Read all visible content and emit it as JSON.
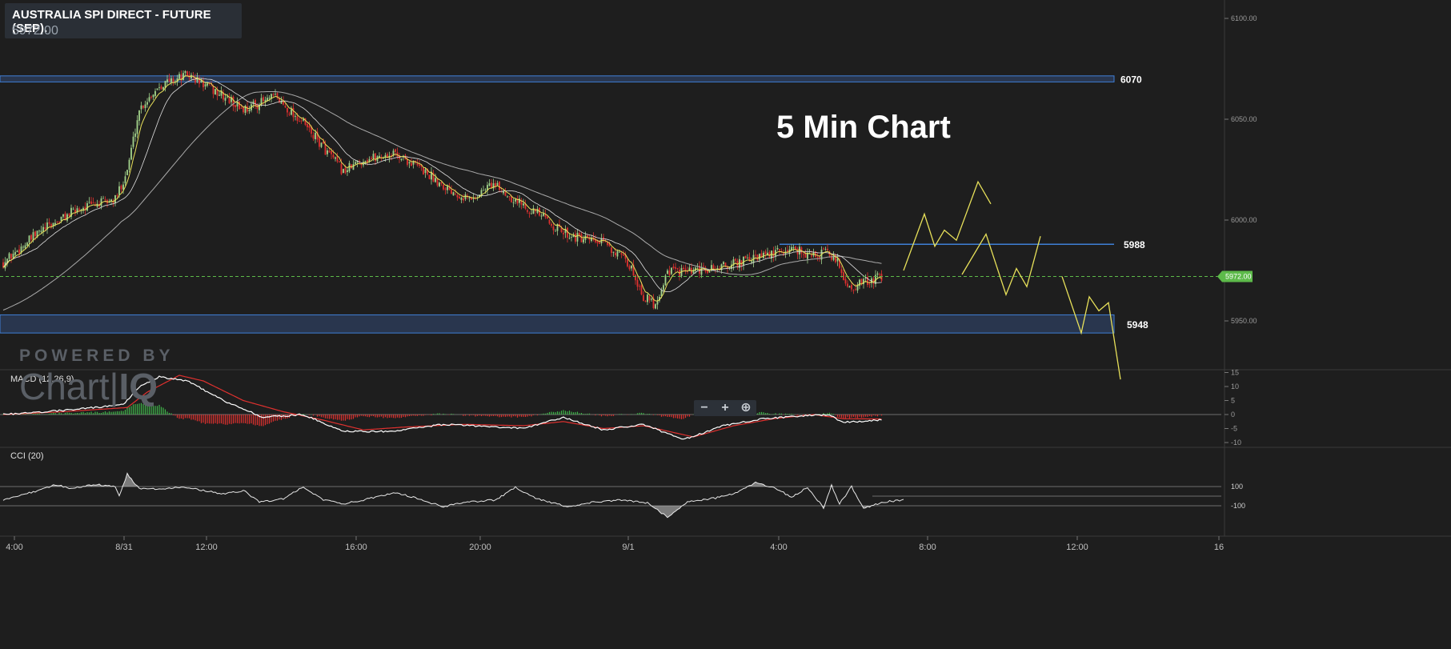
{
  "header": {
    "title": "AUSTRALIA SPI DIRECT - FUTURE (SEP).",
    "price": "5972.00"
  },
  "watermark": {
    "top": "POWERED BY",
    "logo_a": "Chart",
    "logo_b": "IQ"
  },
  "zoom": {
    "minus": "−",
    "plus": "+",
    "fit": "⊕"
  },
  "annotation": "5 Min Chart",
  "colors": {
    "background": "#1e1e1e",
    "up": "#a3d48c",
    "down": "#e0312f",
    "ema_fast": "#e8e15a",
    "ma_slow": "#bdbdbd",
    "level_line": "#3f7fd6",
    "projection": "#e8e15a",
    "price_tag": "#5dba4a",
    "macd": "#ffffff",
    "signal": "#e0312f"
  },
  "chart_data": [
    {
      "type": "candlestick",
      "title": "AUSTRALIA SPI DIRECT - FUTURE (SEP).",
      "ylim": [
        5913,
        6114
      ],
      "y_ticks": [
        "6100.00",
        "6050.00",
        "6000.00",
        "5950.00"
      ],
      "x_ticks": [
        "4:00",
        "8/31",
        "12:00",
        "16:00",
        "20:00",
        "9/1",
        "4:00",
        "8:00",
        "12:00",
        "16"
      ],
      "last_price": "5972.00",
      "levels": [
        {
          "label": "6070",
          "low": 6068.5,
          "high": 6071.5
        },
        {
          "label": "5988",
          "value": 5988
        },
        {
          "label": "5948",
          "low": 5944,
          "high": 5953
        }
      ],
      "trend_anchors": [
        [
          0,
          5979
        ],
        [
          18,
          5994
        ],
        [
          38,
          6006
        ],
        [
          56,
          6010
        ],
        [
          62,
          6025
        ],
        [
          68,
          6055
        ],
        [
          78,
          6067
        ],
        [
          92,
          6072
        ],
        [
          104,
          6065
        ],
        [
          120,
          6055
        ],
        [
          136,
          6061
        ],
        [
          150,
          6048
        ],
        [
          160,
          6036
        ],
        [
          170,
          6024
        ],
        [
          180,
          6030
        ],
        [
          196,
          6033
        ],
        [
          208,
          6026
        ],
        [
          222,
          6016
        ],
        [
          234,
          6010
        ],
        [
          244,
          6018
        ],
        [
          256,
          6010
        ],
        [
          266,
          6004
        ],
        [
          278,
          5995
        ],
        [
          290,
          5990
        ],
        [
          302,
          5988
        ],
        [
          314,
          5976
        ],
        [
          320,
          5962
        ],
        [
          326,
          5958
        ],
        [
          332,
          5975
        ],
        [
          342,
          5974
        ],
        [
          356,
          5976
        ],
        [
          372,
          5980
        ],
        [
          388,
          5984
        ],
        [
          396,
          5986
        ],
        [
          404,
          5982
        ],
        [
          412,
          5984
        ],
        [
          418,
          5978
        ],
        [
          422,
          5966
        ],
        [
          430,
          5969
        ],
        [
          440,
          5972
        ]
      ],
      "projection": [
        {
          "points": [
            [
              1129,
              5975
            ],
            [
              1155,
              6003
            ],
            [
              1168,
              5987
            ],
            [
              1180,
              5995
            ],
            [
              1195,
              5990
            ],
            [
              1222,
              6019
            ],
            [
              1238,
              6008
            ]
          ]
        },
        {
          "points": [
            [
              1202,
              5973
            ],
            [
              1232,
              5993
            ],
            [
              1257,
              5963
            ],
            [
              1270,
              5976
            ],
            [
              1283,
              5967
            ],
            [
              1300,
              5992
            ]
          ]
        },
        {
          "points": [
            [
              1327,
              5972
            ],
            [
              1351,
              5944
            ],
            [
              1361,
              5962
            ],
            [
              1373,
              5955
            ],
            [
              1385,
              5959
            ],
            [
              1400,
              5921
            ]
          ]
        }
      ]
    },
    {
      "type": "line",
      "title": "MACD (12,26,9)",
      "ylim": [
        -13,
        16
      ],
      "y_ticks": [
        "15",
        "10",
        "5",
        "0",
        "-5",
        "-10"
      ],
      "series": [
        {
          "name": "MACD",
          "anchors": [
            [
              0,
              0
            ],
            [
              30,
              1.5
            ],
            [
              60,
              3.5
            ],
            [
              68,
              10
            ],
            [
              78,
              13.5
            ],
            [
              92,
              12
            ],
            [
              110,
              5
            ],
            [
              130,
              -1
            ],
            [
              150,
              0
            ],
            [
              170,
              -6
            ],
            [
              195,
              -6
            ],
            [
              220,
              -3.5
            ],
            [
              260,
              -5
            ],
            [
              280,
              -1
            ],
            [
              300,
              -5.5
            ],
            [
              320,
              -3.5
            ],
            [
              340,
              -9
            ],
            [
              360,
              -4
            ],
            [
              380,
              -1.5
            ],
            [
              400,
              -0.5
            ],
            [
              412,
              0
            ],
            [
              420,
              -2.8
            ],
            [
              440,
              -1.8
            ]
          ]
        },
        {
          "name": "Signal",
          "anchors": [
            [
              0,
              0
            ],
            [
              30,
              1
            ],
            [
              62,
              2.5
            ],
            [
              72,
              8
            ],
            [
              88,
              14
            ],
            [
              100,
              12
            ],
            [
              120,
              5
            ],
            [
              140,
              1
            ],
            [
              160,
              -2
            ],
            [
              180,
              -5.5
            ],
            [
              200,
              -4.5
            ],
            [
              230,
              -3.5
            ],
            [
              260,
              -4
            ],
            [
              280,
              -2.5
            ],
            [
              300,
              -5
            ],
            [
              320,
              -4
            ],
            [
              345,
              -8
            ],
            [
              365,
              -4
            ],
            [
              385,
              -1.5
            ],
            [
              405,
              0
            ],
            [
              420,
              -1.5
            ],
            [
              440,
              -1.6
            ]
          ]
        }
      ]
    },
    {
      "type": "area",
      "title": "CCI (20)",
      "ylim": [
        -300,
        240
      ],
      "y_ticks": [
        "100",
        "-100"
      ],
      "series": [
        {
          "name": "CCI",
          "anchors": [
            [
              0,
              -40
            ],
            [
              8,
              10
            ],
            [
              18,
              60
            ],
            [
              26,
              120
            ],
            [
              34,
              80
            ],
            [
              46,
              120
            ],
            [
              56,
              100
            ],
            [
              58,
              10
            ],
            [
              62,
              230
            ],
            [
              68,
              80
            ],
            [
              78,
              70
            ],
            [
              90,
              100
            ],
            [
              100,
              60
            ],
            [
              110,
              20
            ],
            [
              120,
              60
            ],
            [
              128,
              -60
            ],
            [
              140,
              -30
            ],
            [
              150,
              100
            ],
            [
              160,
              -40
            ],
            [
              170,
              -80
            ],
            [
              180,
              -40
            ],
            [
              196,
              40
            ],
            [
              206,
              -20
            ],
            [
              220,
              -110
            ],
            [
              232,
              -60
            ],
            [
              246,
              -40
            ],
            [
              256,
              90
            ],
            [
              266,
              -20
            ],
            [
              282,
              -110
            ],
            [
              296,
              -60
            ],
            [
              310,
              -40
            ],
            [
              322,
              -70
            ],
            [
              332,
              -220
            ],
            [
              342,
              -60
            ],
            [
              356,
              -20
            ],
            [
              366,
              30
            ],
            [
              376,
              140
            ],
            [
              386,
              80
            ],
            [
              394,
              -10
            ],
            [
              402,
              90
            ],
            [
              410,
              -120
            ],
            [
              414,
              110
            ],
            [
              418,
              -80
            ],
            [
              424,
              100
            ],
            [
              430,
              -130
            ],
            [
              440,
              -60
            ],
            [
              450,
              -40
            ]
          ]
        }
      ]
    }
  ]
}
